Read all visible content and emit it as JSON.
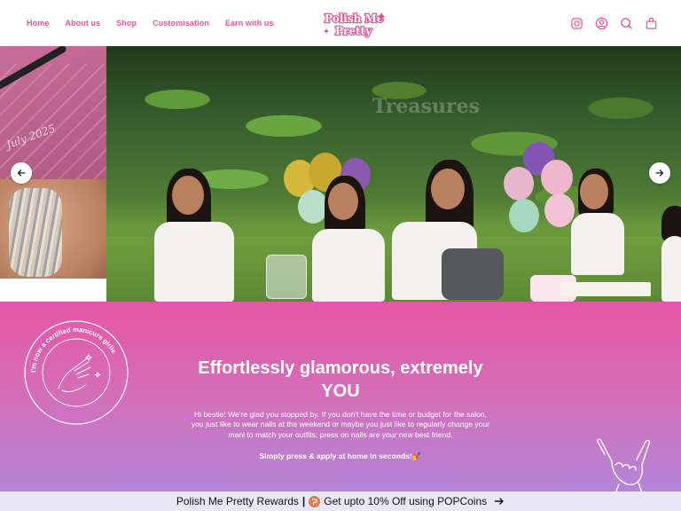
{
  "header": {
    "nav": [
      "Home",
      "About us",
      "Shop",
      "Customisation",
      "Earn with us"
    ],
    "logo_text": [
      "Polish Me",
      "Pretty"
    ],
    "icons": [
      "instagram-icon",
      "account-icon",
      "search-icon",
      "cart-icon"
    ]
  },
  "hero": {
    "left_slide_text": "July 2025",
    "watermark": "Treasures",
    "prev_icon": "arrow-left-icon",
    "next_icon": "arrow-right-icon"
  },
  "promo": {
    "badge_text": "I'm now a certified manicure girlie",
    "title": "Effortlessly glamorous, extremely YOU",
    "body": "Hi bestie! We're glad you stopped by. If you don't have the time or budget for the salon, you just like to wear nails at the weekend or maybe you just like to regularly change your mani to match your outfits; press on nails are your new best friend.",
    "cta": "Simply press & apply at home in seconds!💅"
  },
  "rewards": {
    "left": "Polish Me Pretty Rewards",
    "separator": "|",
    "right": "Get upto 10% Off using POPCoins",
    "arrow_icon": "arrow-right-icon"
  },
  "colors": {
    "brand_pink": "#e0559a",
    "gradient_top": "#e557a6",
    "gradient_bottom": "#b485d9",
    "rewards_bg": "#e9e7f4"
  }
}
